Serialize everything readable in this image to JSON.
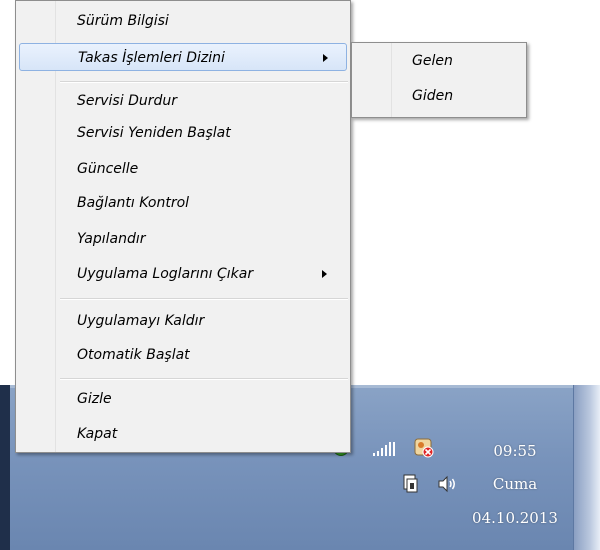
{
  "menu": {
    "items": [
      {
        "label": "Sürüm Bilgisi"
      },
      {
        "label": "Takas İşlemleri Dizini",
        "has_submenu": true,
        "highlighted": true
      },
      {
        "label": "Servisi Durdur"
      },
      {
        "label": "Servisi Yeniden Başlat"
      },
      {
        "label": "Güncelle"
      },
      {
        "label": "Bağlantı Kontrol"
      },
      {
        "label": "Yapılandır"
      },
      {
        "label": "Uygulama Loglarını Çıkar",
        "has_submenu": true
      },
      {
        "label": "Uygulamayı Kaldır"
      },
      {
        "label": "Otomatik Başlat"
      },
      {
        "label": "Gizle"
      },
      {
        "label": "Kapat"
      }
    ]
  },
  "submenu": {
    "items": [
      {
        "label": "Gelen"
      },
      {
        "label": "Giden"
      }
    ]
  },
  "tray": {
    "icons": [
      "shield-icon",
      "signal-bars-icon",
      "error-badge-icon",
      "network-icon",
      "volume-icon"
    ]
  },
  "clock": {
    "time": "09:55",
    "day": "Cuma",
    "date": "04.10.2013"
  },
  "colors": {
    "taskbar": "#7893bb",
    "menu_bg": "#f1f1f1",
    "highlight": "#d7e5f8",
    "highlight_border": "#8eb2e2"
  }
}
